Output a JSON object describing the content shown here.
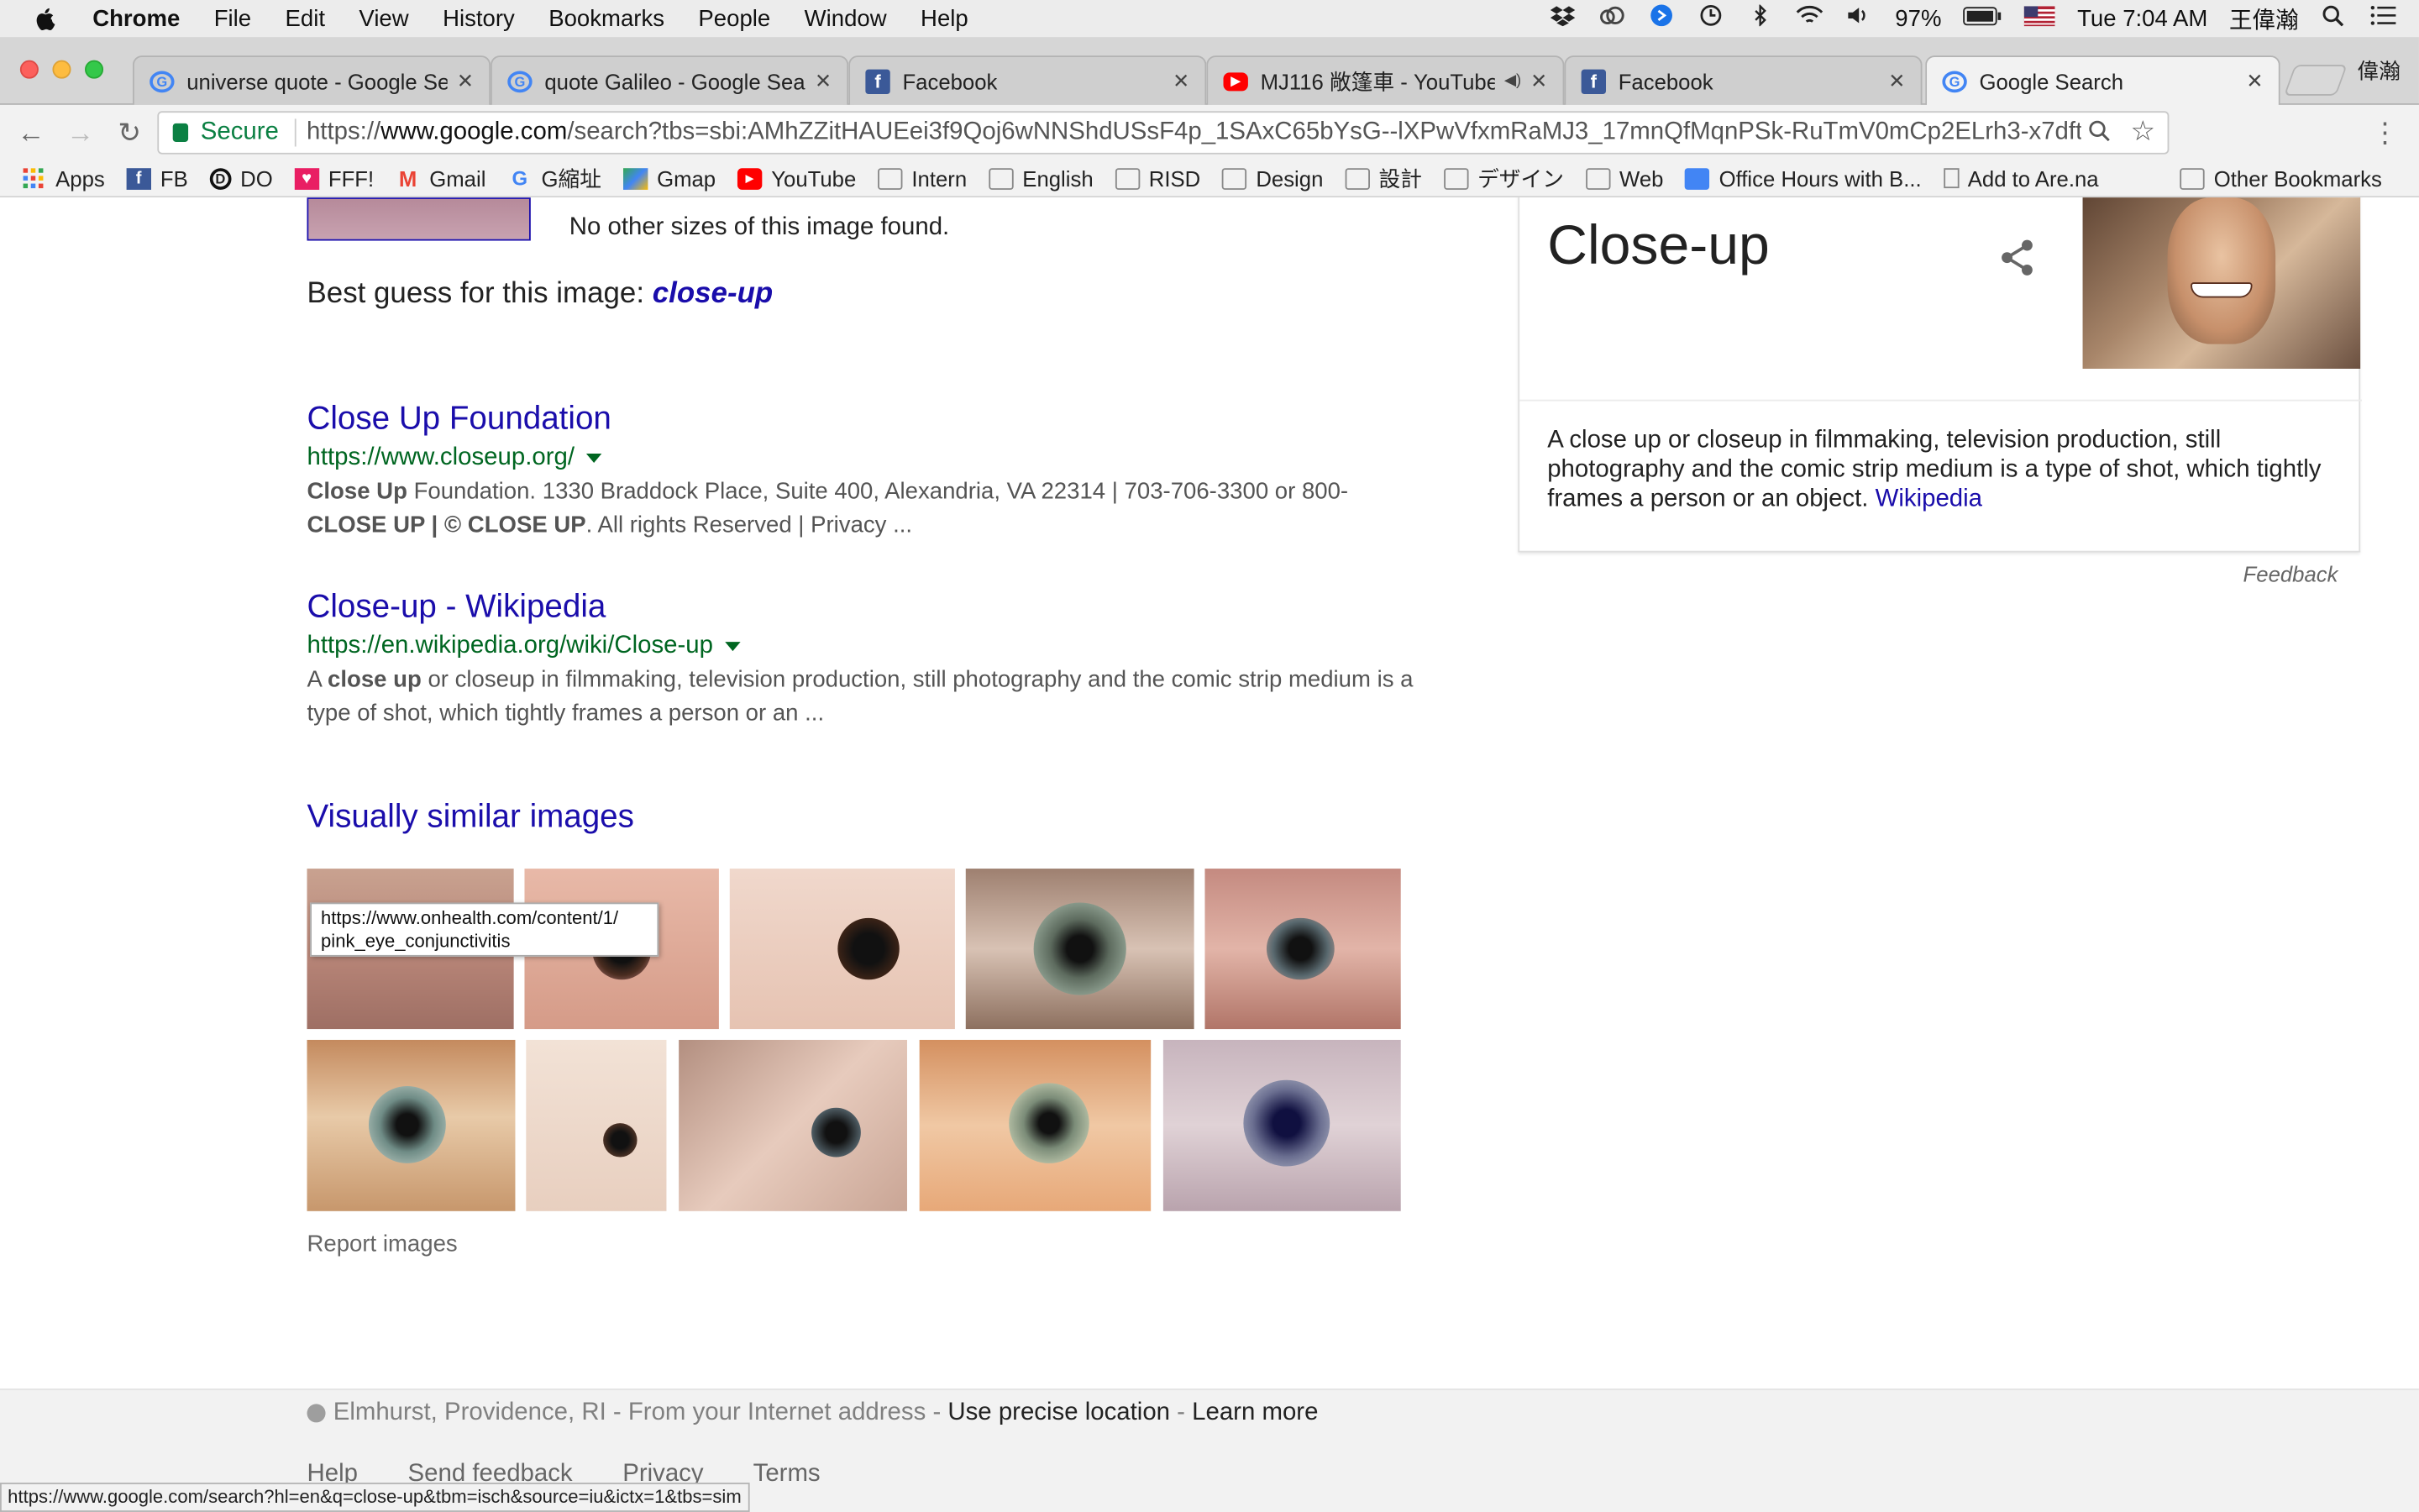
{
  "menubar": {
    "app": "Chrome",
    "items": [
      "File",
      "Edit",
      "View",
      "History",
      "Bookmarks",
      "People",
      "Window",
      "Help"
    ],
    "battery": "97%",
    "clock": "Tue 7:04 AM",
    "user": "王偉瀚"
  },
  "tabs": [
    {
      "title": "universe quote - Google Se",
      "icon": "google-icon"
    },
    {
      "title": "quote Galileo - Google Sear",
      "icon": "google-icon"
    },
    {
      "title": "Facebook",
      "icon": "facebook-icon"
    },
    {
      "title": "MJ116 敞篷車 - YouTube",
      "icon": "youtube-icon"
    },
    {
      "title": "Facebook",
      "icon": "facebook-icon"
    },
    {
      "title": "Google Search",
      "icon": "google-icon"
    }
  ],
  "profile_name": "偉瀚",
  "toolbar": {
    "secure_label": "Secure",
    "url_prefix": "https://",
    "url_host": "www.google.com",
    "url_rest": "/search?tbs=sbi:AMhZZitHAUEei3f9Qoj6wNNShdUSsF4p_1SAxC65bYsG--lXPwVfxmRaMJ3_17mnQfMqnPSk-RuTmV0mCp2ELrh3-x7dftu..."
  },
  "bookmarks": [
    "Apps",
    "FB",
    "DO",
    "FFF!",
    "Gmail",
    "G縮址",
    "Gmap",
    "YouTube",
    "Intern",
    "English",
    "RISD",
    "Design",
    "設計",
    "デザイン",
    "Web",
    "Office Hours with B...",
    "Add to Are.na"
  ],
  "other_bookmarks": "Other Bookmarks",
  "search": {
    "no_sizes": "No other sizes of this image found.",
    "best_guess_prefix": "Best guess for this image: ",
    "best_guess_term": "close-up",
    "results": [
      {
        "title": "Close Up Foundation",
        "url": "https://www.closeup.org/",
        "snippet_line1_bold": "Close Up",
        "snippet_line1_rest": " Foundation. 1330 Braddock Place, Suite 400, Alexandria, VA 22314 | 703-706-3300 or 800-",
        "snippet_line2_bold": "CLOSE UP | © CLOSE UP",
        "snippet_line2_rest": ". All rights Reserved | Privacy ..."
      },
      {
        "title": "Close-up - Wikipedia",
        "url": "https://en.wikipedia.org/wiki/Close-up",
        "snippet_pre": "A ",
        "snippet_bold": "close up",
        "snippet_post": " or closeup in filmmaking, television production, still photography and the comic strip medium is a type of shot, which tightly frames a person or an ..."
      }
    ],
    "visually_similar": "Visually similar images",
    "tooltip_line1": "https://www.onhealth.com/content/1/",
    "tooltip_line2": "pink_eye_conjunctivitis",
    "report_images": "Report images"
  },
  "knowledge_panel": {
    "title": "Close-up",
    "description": "A close up or closeup in filmmaking, television production, still photography and the comic strip medium is a type of shot, which tightly frames a person or an object. ",
    "source": "Wikipedia",
    "feedback": "Feedback"
  },
  "footer": {
    "location": "Elmhurst, Providence, RI",
    "location_source": " - From your Internet address - ",
    "precise": "Use precise location",
    "sep": " - ",
    "learn_more": "Learn more",
    "links": [
      "Help",
      "Send feedback",
      "Privacy",
      "Terms"
    ]
  },
  "status_url": "https://www.google.com/search?hl=en&q=close-up&tbm=isch&source=iu&ictx=1&tbs=sim"
}
